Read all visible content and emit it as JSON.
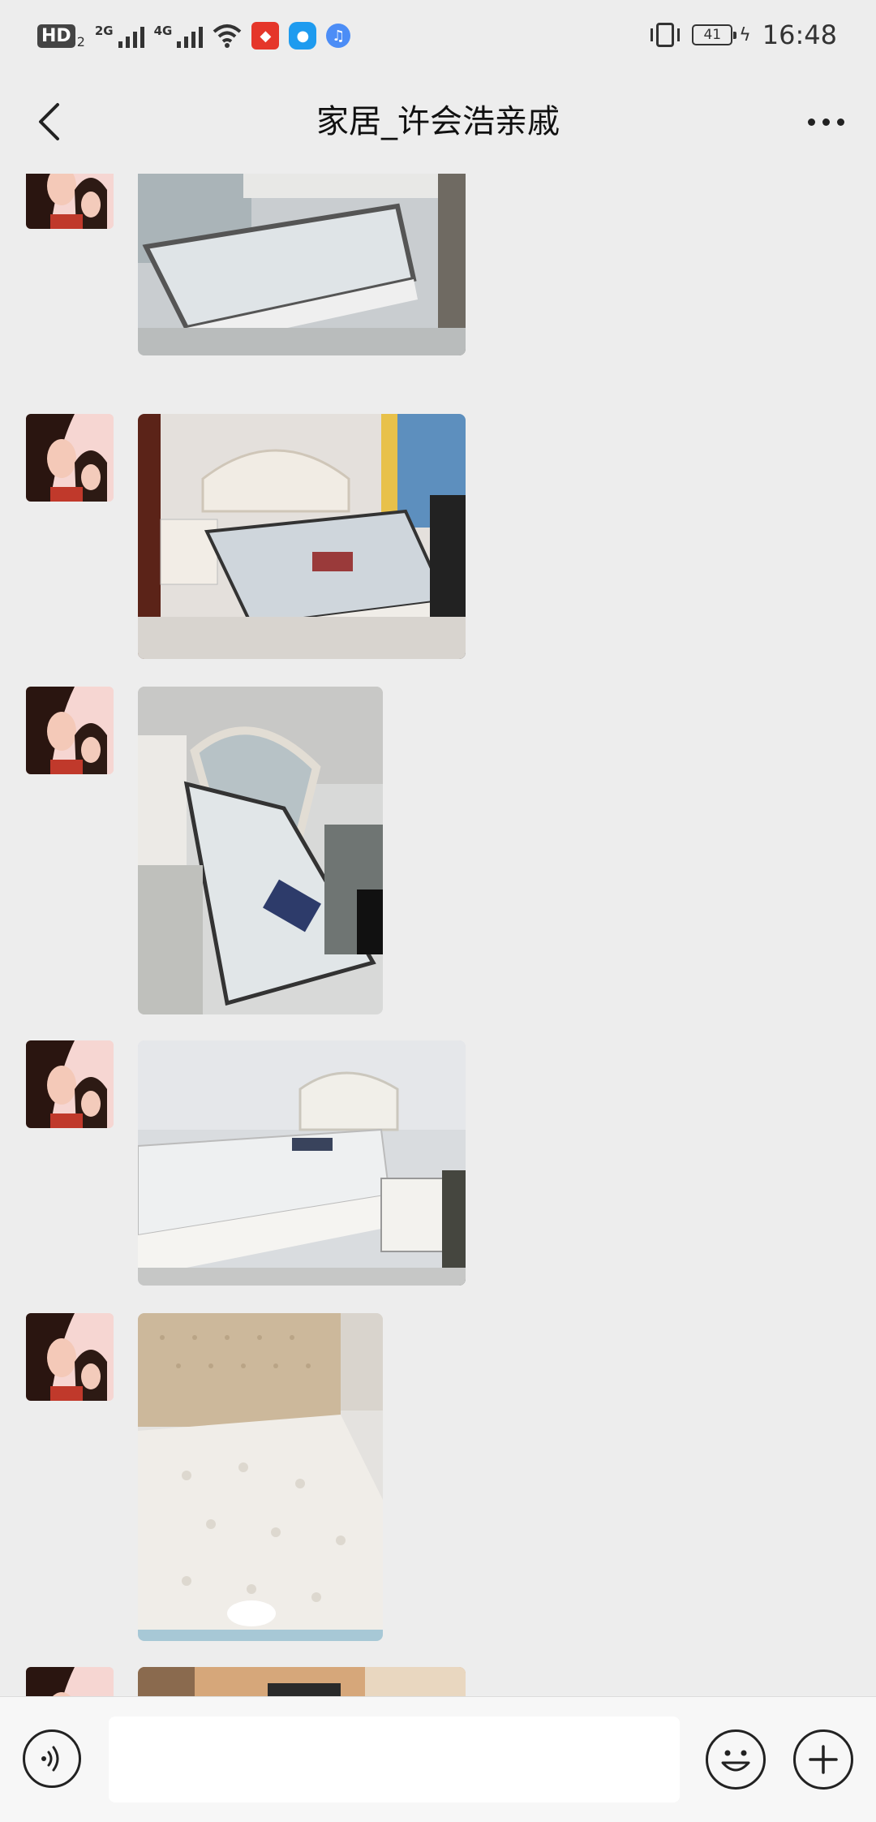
{
  "status_bar": {
    "hd_label": "HD",
    "hd_sub": "2",
    "net1": "2G",
    "net2": "4G",
    "battery_level": "41",
    "time": "16:48"
  },
  "header": {
    "title": "家居_许会浩亲戚",
    "back_icon": "chevron-left-icon",
    "more_icon": "more-icon"
  },
  "messages": [
    {
      "type": "image",
      "sender": "contact",
      "subject": "white bed with plastic-wrapped mattress"
    },
    {
      "type": "image",
      "sender": "contact",
      "subject": "white tufted bed with nightstand"
    },
    {
      "type": "image",
      "sender": "contact",
      "subject": "bed with wrapped mattress, angled view"
    },
    {
      "type": "image",
      "sender": "contact",
      "subject": "white carved bed with nightstand"
    },
    {
      "type": "image",
      "sender": "contact",
      "subject": "beige headboard bed with quilted mattress"
    },
    {
      "type": "image",
      "sender": "contact",
      "subject": "room photo (partially visible)"
    }
  ],
  "input_bar": {
    "voice_icon": "voice-icon",
    "text_value": "",
    "emoji_icon": "emoji-icon",
    "plus_icon": "plus-icon"
  },
  "colors": {
    "background": "#ededed",
    "input_bar": "#f7f7f7",
    "app_icon_red": "#e5362a",
    "app_icon_blue": "#1e9bef"
  }
}
